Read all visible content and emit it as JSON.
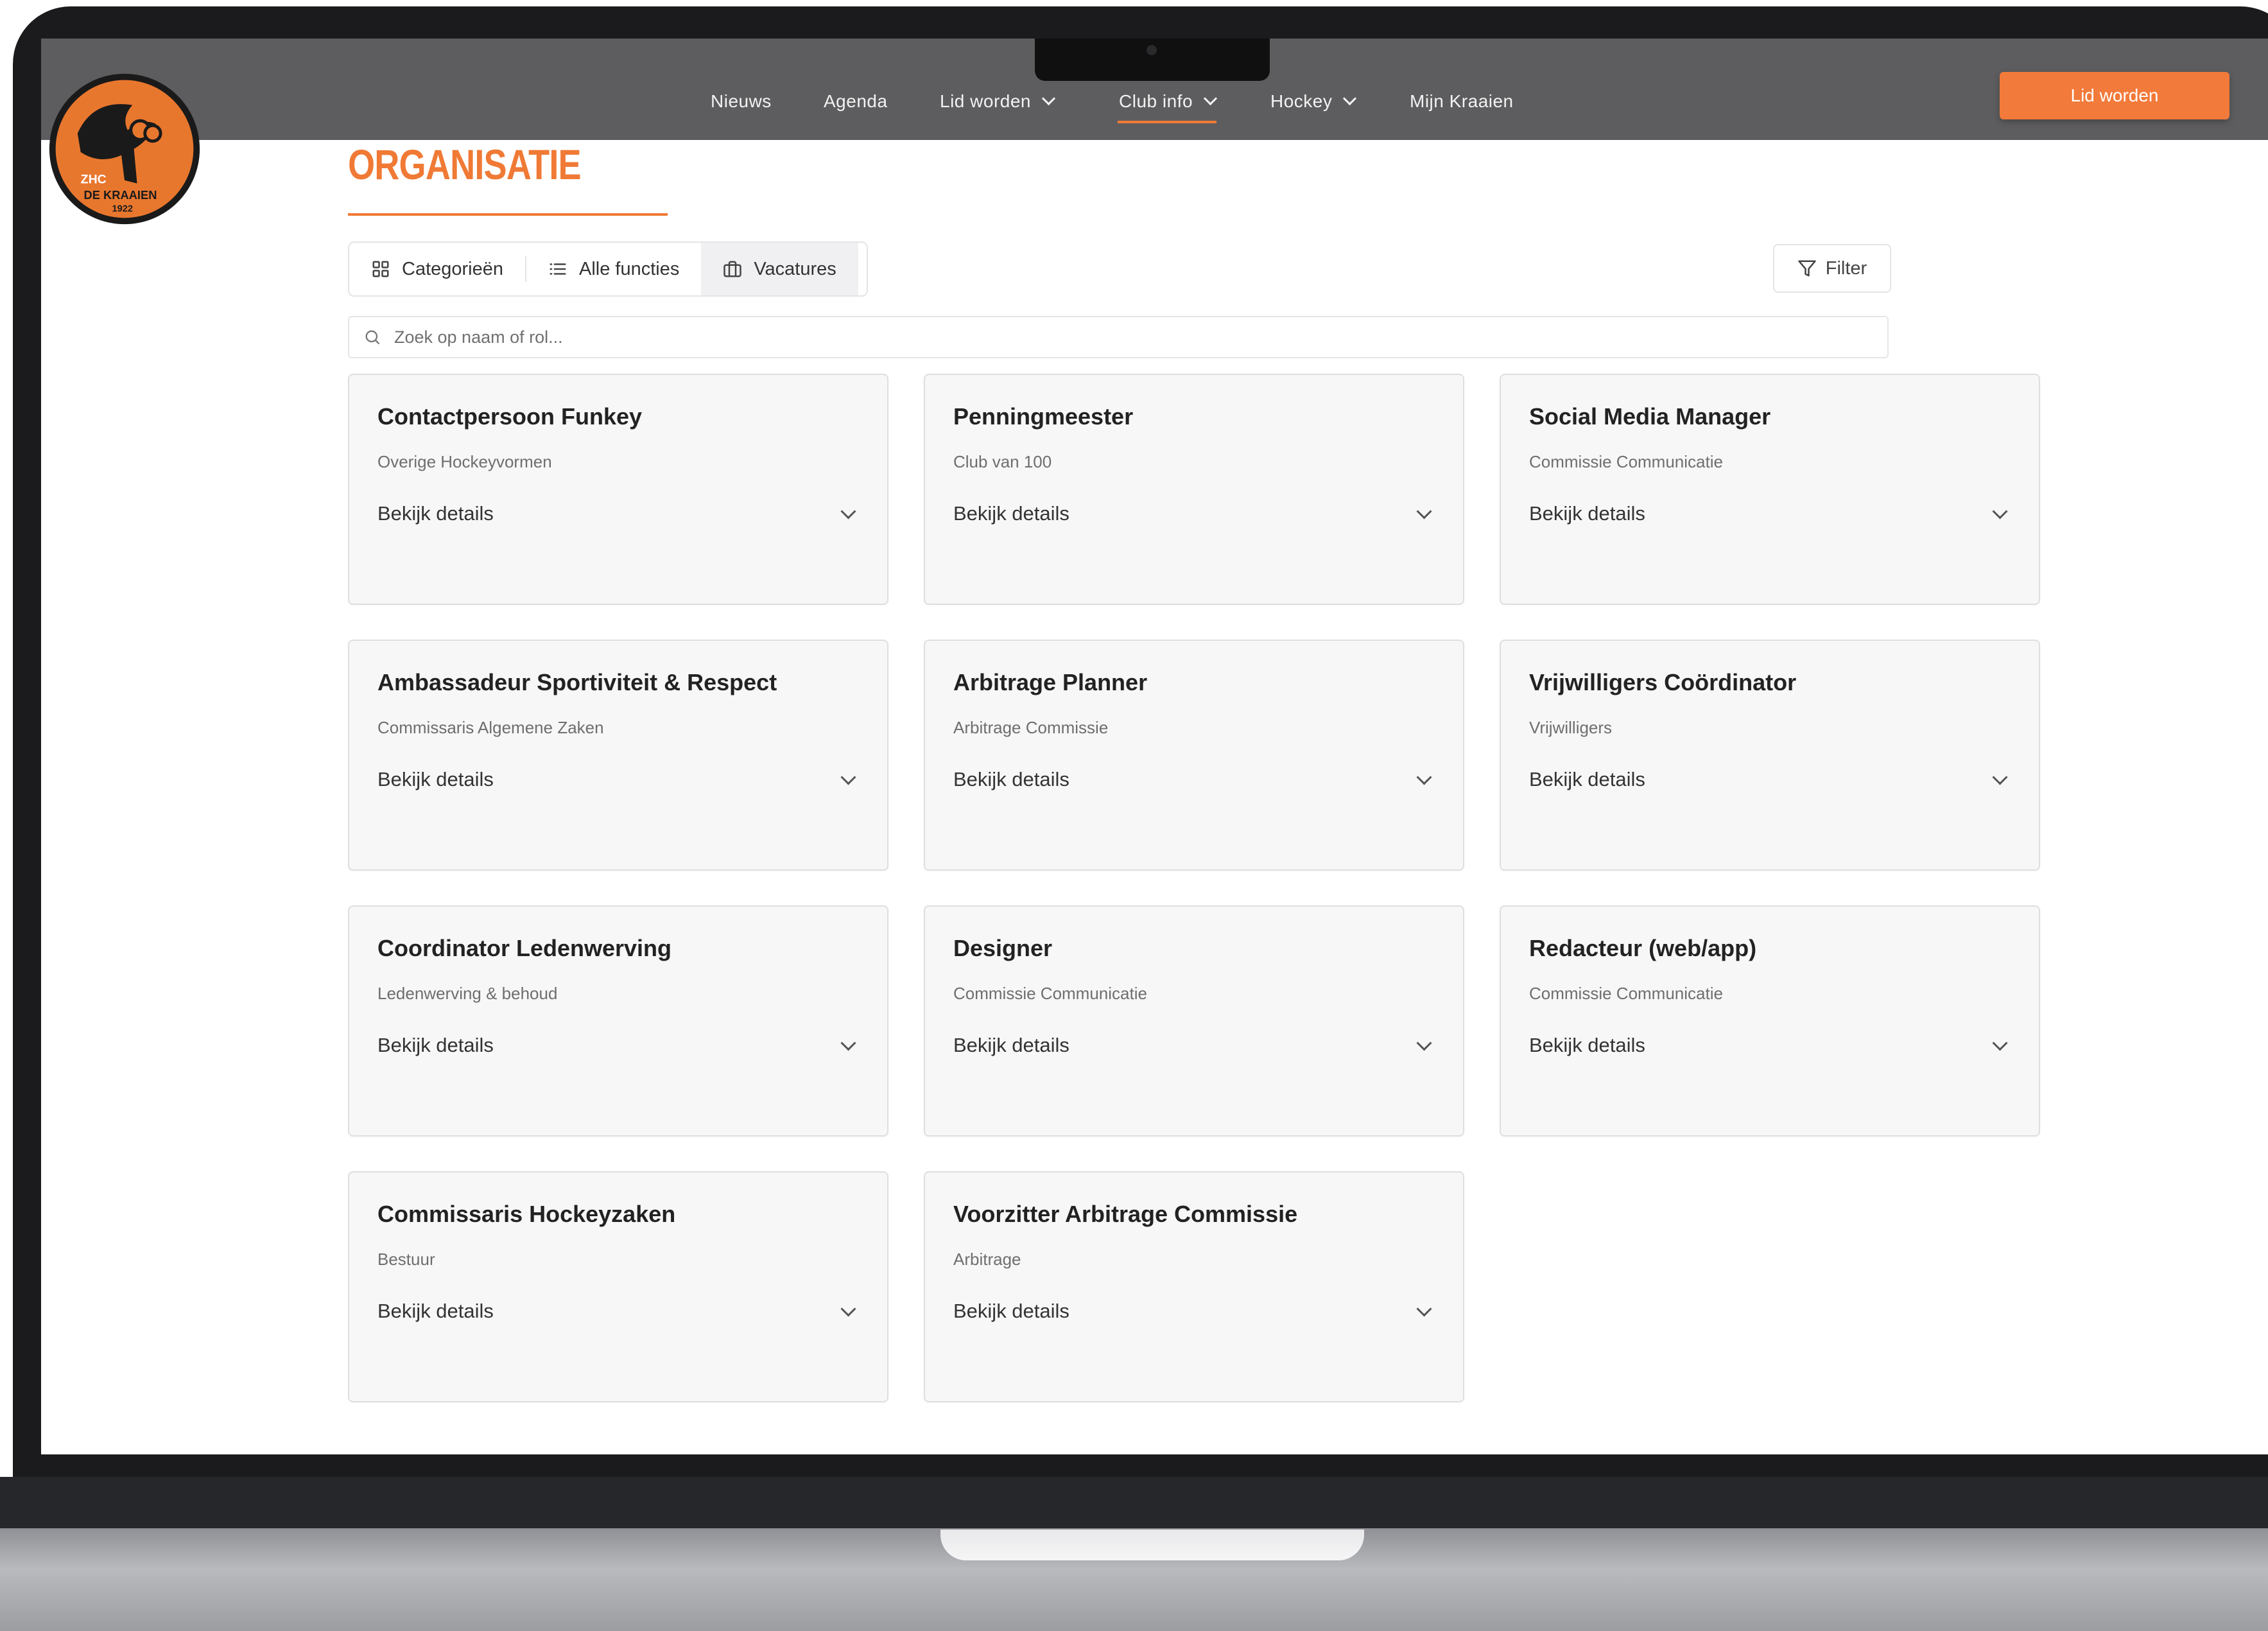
{
  "nav": {
    "items": [
      {
        "label": "Nieuws",
        "dropdown": false
      },
      {
        "label": "Agenda",
        "dropdown": false
      },
      {
        "label": "Lid worden",
        "dropdown": true
      },
      {
        "label": "Club info",
        "dropdown": true,
        "active": true
      },
      {
        "label": "Hockey",
        "dropdown": true
      },
      {
        "label": "Mijn Kraaien",
        "dropdown": false
      }
    ],
    "cta_label": "Lid worden"
  },
  "logo": {
    "line1": "ZHC",
    "line2": "DE KRAAIEN",
    "line3": "1922"
  },
  "page": {
    "title": "ORGANISATIE"
  },
  "tabs": [
    {
      "label": "Categorieën",
      "icon": "grid-icon"
    },
    {
      "label": "Alle functies",
      "icon": "list-icon"
    },
    {
      "label": "Vacatures",
      "icon": "briefcase-icon",
      "active": true
    }
  ],
  "filter": {
    "label": "Filter"
  },
  "search": {
    "placeholder": "Zoek op naam of rol...",
    "value": ""
  },
  "cards": [
    {
      "title": "Contactpersoon Funkey",
      "subtitle": "Overige Hockeyvormen",
      "details_label": "Bekijk details"
    },
    {
      "title": "Penningmeester",
      "subtitle": "Club van 100",
      "details_label": "Bekijk details"
    },
    {
      "title": "Social Media Manager",
      "subtitle": "Commissie Communicatie",
      "details_label": "Bekijk details"
    },
    {
      "title": "Ambassadeur Sportiviteit & Respect",
      "subtitle": "Commissaris Algemene Zaken",
      "details_label": "Bekijk details"
    },
    {
      "title": "Arbitrage Planner",
      "subtitle": "Arbitrage Commissie",
      "details_label": "Bekijk details"
    },
    {
      "title": "Vrijwilligers Coördinator",
      "subtitle": "Vrijwilligers",
      "details_label": "Bekijk details"
    },
    {
      "title": "Coordinator Ledenwerving",
      "subtitle": "Ledenwerving & behoud",
      "details_label": "Bekijk details"
    },
    {
      "title": "Designer",
      "subtitle": "Commissie Communicatie",
      "details_label": "Bekijk details"
    },
    {
      "title": "Redacteur (web/app)",
      "subtitle": "Commissie Communicatie",
      "details_label": "Bekijk details"
    },
    {
      "title": "Commissaris Hockeyzaken",
      "subtitle": "Bestuur",
      "details_label": "Bekijk details"
    },
    {
      "title": "Voorzitter Arbitrage Commissie",
      "subtitle": "Arbitrage",
      "details_label": "Bekijk details"
    }
  ],
  "colors": {
    "accent": "#f07a35",
    "nav_bg": "#5d5d5f",
    "card_bg": "#f7f7f8",
    "logo_bg": "#e8772e"
  }
}
